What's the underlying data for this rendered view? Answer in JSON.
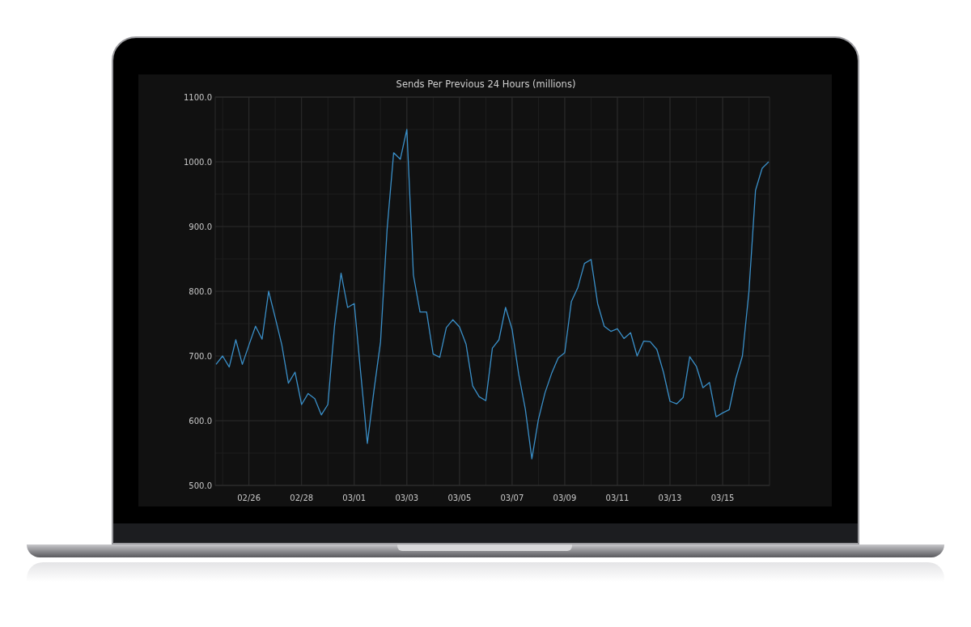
{
  "chart": {
    "chart_data": {
      "type": "line",
      "title": "Sends Per Previous 24 Hours (millions)",
      "grid": true,
      "ylim": [
        500,
        1100
      ],
      "categories": [
        null,
        null,
        null,
        null,
        null,
        "02/26",
        null,
        null,
        null,
        null,
        null,
        null,
        null,
        "02/28",
        null,
        null,
        null,
        null,
        null,
        null,
        null,
        "03/01",
        null,
        null,
        null,
        null,
        null,
        null,
        null,
        "03/03",
        null,
        null,
        null,
        null,
        null,
        null,
        null,
        "03/05",
        null,
        null,
        null,
        null,
        null,
        null,
        null,
        "03/07",
        null,
        null,
        null,
        null,
        null,
        null,
        null,
        "03/09",
        null,
        null,
        null,
        null,
        null,
        null,
        null,
        "03/11",
        null,
        null,
        null,
        null,
        null,
        null,
        null,
        "03/13",
        null,
        null,
        null,
        null,
        null,
        null,
        null,
        "03/15",
        null,
        null,
        null,
        null,
        null,
        null,
        null
      ],
      "yticks": [
        {
          "value": 500,
          "label": "500.0"
        },
        {
          "value": 600,
          "label": "600.0"
        },
        {
          "value": 700,
          "label": "700.0"
        },
        {
          "value": 800,
          "label": "800.0"
        },
        {
          "value": 900,
          "label": "900.0"
        },
        {
          "value": 1000,
          "label": "1000.0"
        },
        {
          "value": 1100,
          "label": "1100.0"
        }
      ],
      "series": [
        {
          "color": "#3a8fc8",
          "values": [
            687,
            700,
            683,
            725,
            687,
            717,
            746,
            726,
            800,
            759,
            717,
            658,
            675,
            625,
            642,
            634,
            609,
            625,
            746,
            828,
            775,
            781,
            672,
            565,
            646,
            722,
            896,
            1014,
            1004,
            1050,
            825,
            768,
            768,
            703,
            698,
            744,
            756,
            745,
            718,
            654,
            637,
            631,
            712,
            725,
            775,
            741,
            672,
            618,
            541,
            602,
            643,
            673,
            697,
            705,
            784,
            806,
            843,
            849,
            781,
            746,
            738,
            742,
            727,
            736,
            700,
            723,
            722,
            710,
            675,
            630,
            626,
            636,
            699,
            684,
            651,
            659,
            606,
            612,
            617,
            665,
            700,
            800,
            956,
            990,
            1000
          ]
        }
      ]
    }
  }
}
